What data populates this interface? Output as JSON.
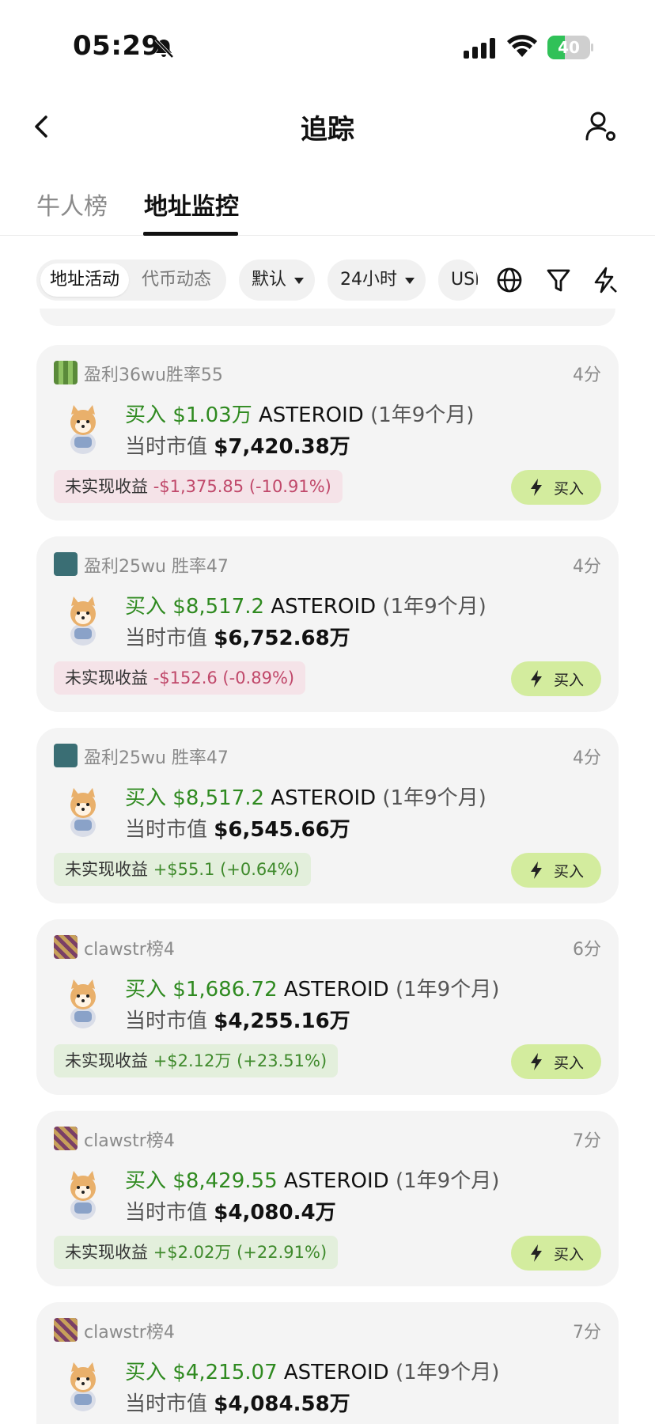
{
  "status_bar": {
    "time": "05:29",
    "battery": "40",
    "battery_level": 0.4
  },
  "nav": {
    "title": "追踪"
  },
  "tabs": [
    {
      "label": "牛人榜",
      "active": false
    },
    {
      "label": "地址监控",
      "active": true
    }
  ],
  "filters": {
    "segment": [
      "地址活动",
      "代币动态"
    ],
    "sort": "默认",
    "period": "24小时",
    "currency": "USD"
  },
  "feed": [
    {
      "wallet": "盈利36wu胜率55",
      "time": "4分",
      "action": "买入",
      "amount": "$1.03万",
      "token": "ASTEROID",
      "age": "(1年9个月)",
      "mcap_label": "当时市值",
      "mcap": "$7,420.38万",
      "pnl_label": "未实现收益",
      "pnl": "-$1,375.85 (-10.91%)",
      "pnl_sign": "neg",
      "button": "买入"
    },
    {
      "wallet": "盈利25wu 胜率47",
      "time": "4分",
      "action": "买入",
      "amount": "$8,517.2",
      "token": "ASTEROID",
      "age": "(1年9个月)",
      "mcap_label": "当时市值",
      "mcap": "$6,752.68万",
      "pnl_label": "未实现收益",
      "pnl": "-$152.6 (-0.89%)",
      "pnl_sign": "neg",
      "button": "买入"
    },
    {
      "wallet": "盈利25wu 胜率47",
      "time": "4分",
      "action": "买入",
      "amount": "$8,517.2",
      "token": "ASTEROID",
      "age": "(1年9个月)",
      "mcap_label": "当时市值",
      "mcap": "$6,545.66万",
      "pnl_label": "未实现收益",
      "pnl": "+$55.1 (+0.64%)",
      "pnl_sign": "pos",
      "button": "买入"
    },
    {
      "wallet": "clawstr榜4",
      "time": "6分",
      "action": "买入",
      "amount": "$1,686.72",
      "token": "ASTEROID",
      "age": "(1年9个月)",
      "mcap_label": "当时市值",
      "mcap": "$4,255.16万",
      "pnl_label": "未实现收益",
      "pnl": "+$2.12万 (+23.51%)",
      "pnl_sign": "pos",
      "button": "买入"
    },
    {
      "wallet": "clawstr榜4",
      "time": "7分",
      "action": "买入",
      "amount": "$8,429.55",
      "token": "ASTEROID",
      "age": "(1年9个月)",
      "mcap_label": "当时市值",
      "mcap": "$4,080.4万",
      "pnl_label": "未实现收益",
      "pnl": "+$2.02万 (+22.91%)",
      "pnl_sign": "pos",
      "button": "买入"
    },
    {
      "wallet": "clawstr榜4",
      "time": "7分",
      "action": "买入",
      "amount": "$4,215.07",
      "token": "ASTEROID",
      "age": "(1年9个月)",
      "mcap_label": "当时市值",
      "mcap": "$4,084.58万",
      "pnl_label": "",
      "pnl": "",
      "pnl_sign": "pos",
      "button": ""
    }
  ]
}
